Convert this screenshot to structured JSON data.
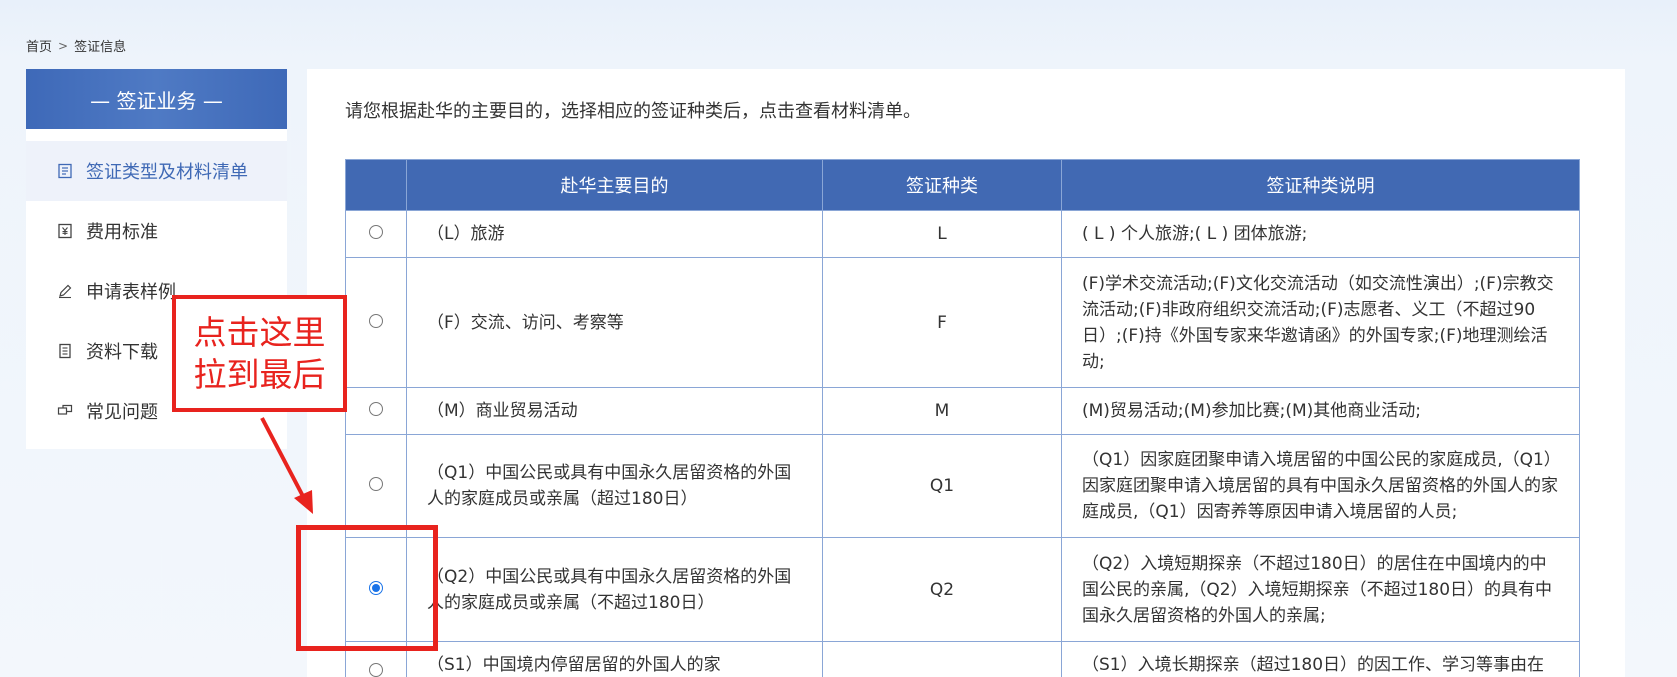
{
  "breadcrumb": {
    "home": "首页",
    "separator": ">",
    "current": "签证信息"
  },
  "sidebar": {
    "title": "— 签证业务 —",
    "items": [
      {
        "label": "签证类型及材料清单",
        "icon": "list-icon",
        "active": true
      },
      {
        "label": "费用标准",
        "icon": "yen-icon",
        "active": false
      },
      {
        "label": "申请表样例",
        "icon": "pen-icon",
        "active": false
      },
      {
        "label": "资料下载",
        "icon": "document-icon",
        "active": false
      },
      {
        "label": "常见问题",
        "icon": "chat-icon",
        "active": false
      }
    ]
  },
  "main": {
    "intro": "请您根据赴华的主要目的，选择相应的签证种类后，点击查看材料清单。",
    "table": {
      "headers": [
        "",
        "赴华主要目的",
        "签证种类",
        "签证种类说明"
      ],
      "rows": [
        {
          "selected": false,
          "purpose": "（L）旅游",
          "type": "L",
          "desc": "( L ) 个人旅游;( L ) 团体旅游;"
        },
        {
          "selected": false,
          "purpose": "（F）交流、访问、考察等",
          "type": "F",
          "desc": "(F)学术交流活动;(F)文化交流活动（如交流性演出）;(F)宗教交流活动;(F)非政府组织交流活动;(F)志愿者、义工（不超过90日）;(F)持《外国专家来华邀请函》的外国专家;(F)地理测绘活动;"
        },
        {
          "selected": false,
          "purpose": "（M）商业贸易活动",
          "type": "M",
          "desc": "(M)贸易活动;(M)参加比赛;(M)其他商业活动;"
        },
        {
          "selected": false,
          "purpose": "（Q1）中国公民或具有中国永久居留资格的外国人的家庭成员或亲属（超过180日）",
          "type": "Q1",
          "desc": "（Q1）因家庭团聚申请入境居留的中国公民的家庭成员,（Q1）因家庭团聚申请入境居留的具有中国永久居留资格的外国人的家庭成员,（Q1）因寄养等原因申请入境居留的人员;"
        },
        {
          "selected": true,
          "purpose": "（Q2）中国公民或具有中国永久居留资格的外国人的家庭成员或亲属（不超过180日）",
          "type": "Q2",
          "desc": "（Q2）入境短期探亲（不超过180日）的居住在中国境内的中国公民的亲属,（Q2）入境短期探亲（不超过180日）的具有中国永久居留资格的外国人的亲属;"
        },
        {
          "selected": false,
          "purpose": "（S1）中国境内停留居留的外国人的家",
          "type": "",
          "desc": "（S1）入境长期探亲（超过180日）的因工作、学习等事由在"
        }
      ]
    }
  },
  "annotation": {
    "line1": "点击这里",
    "line2": "拉到最后",
    "color": "#e8231e"
  },
  "colors": {
    "accent": "#4169b3",
    "radio_selected": "#1a73e8"
  }
}
